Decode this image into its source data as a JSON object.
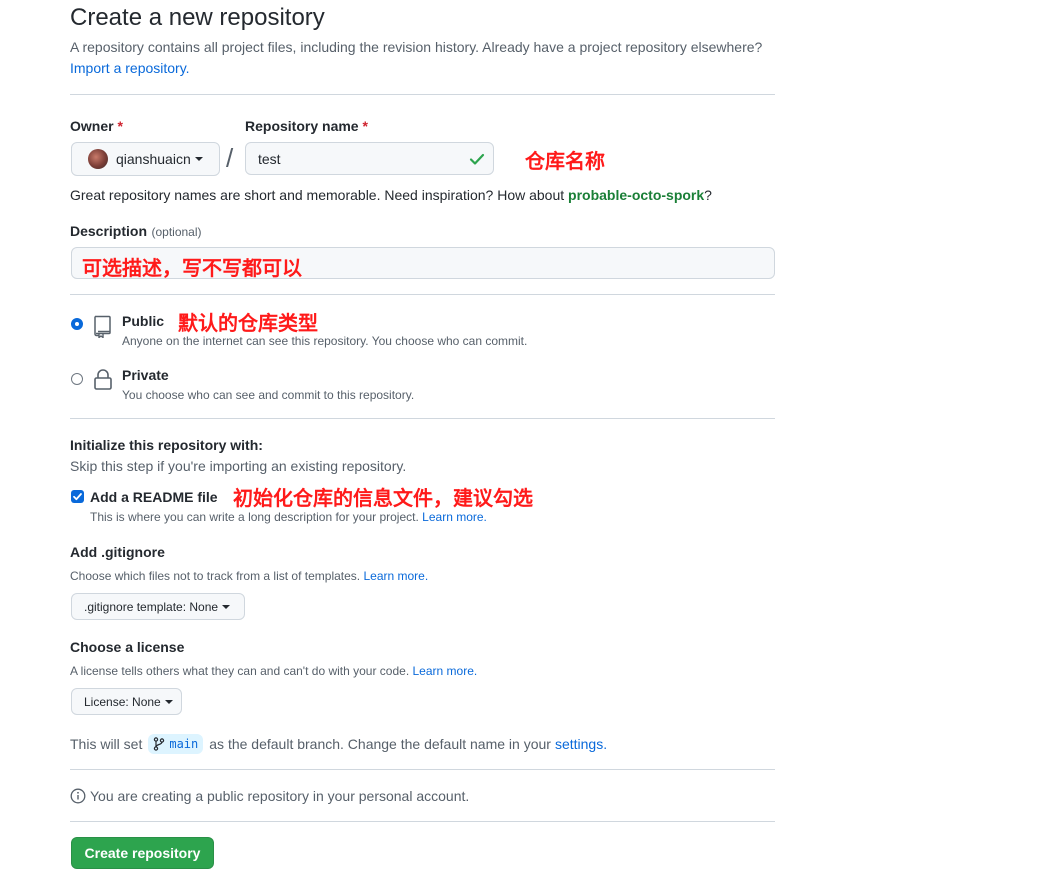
{
  "header": {
    "title": "Create a new repository",
    "subtitle": "A repository contains all project files, including the revision history. Already have a project repository elsewhere?",
    "import_link": "Import a repository."
  },
  "owner": {
    "label": "Owner",
    "required_mark": "*",
    "value": "qianshuaicn"
  },
  "separator": "/",
  "repo_name": {
    "label": "Repository name",
    "required_mark": "*",
    "value": "test",
    "annotation": "仓库名称"
  },
  "suggestion": {
    "text": "Great repository names are short and memorable. Need inspiration? How about",
    "name": "probable-octo-spork",
    "end": "?"
  },
  "description": {
    "label": "Description",
    "optional": "(optional)",
    "annotation": "可选描述，写不写都可以"
  },
  "visibility": {
    "annotation": "默认的仓库类型",
    "public": {
      "label": "Public",
      "desc": "Anyone on the internet can see this repository. You choose who can commit.",
      "selected": true
    },
    "private": {
      "label": "Private",
      "desc": "You choose who can see and commit to this repository.",
      "selected": false
    }
  },
  "init": {
    "title": "Initialize this repository with:",
    "subtitle": "Skip this step if you're importing an existing repository.",
    "readme": {
      "label": "Add a README file",
      "checked": true,
      "desc": "This is where you can write a long description for your project.",
      "link": "Learn more.",
      "annotation": "初始化仓库的信息文件，建议勾选"
    }
  },
  "gitignore": {
    "title": "Add .gitignore",
    "desc": "Choose which files not to track from a list of templates.",
    "link": "Learn more.",
    "button": ".gitignore template: None"
  },
  "license": {
    "title": "Choose a license",
    "desc": "A license tells others what they can and can't do with your code.",
    "link": "Learn more.",
    "button": "License: None"
  },
  "branch": {
    "prefix": "This will set",
    "name": "main",
    "middle": "as the default branch. Change the default name in your",
    "link": "settings."
  },
  "info": {
    "text": "You are creating a public repository in your personal account."
  },
  "submit": {
    "label": "Create repository"
  },
  "colors": {
    "primary_button": "#2da44e",
    "link": "#0969da",
    "annotation": "#ff1a1a",
    "valid_check": "#2da44e",
    "required": "#cf222e"
  }
}
